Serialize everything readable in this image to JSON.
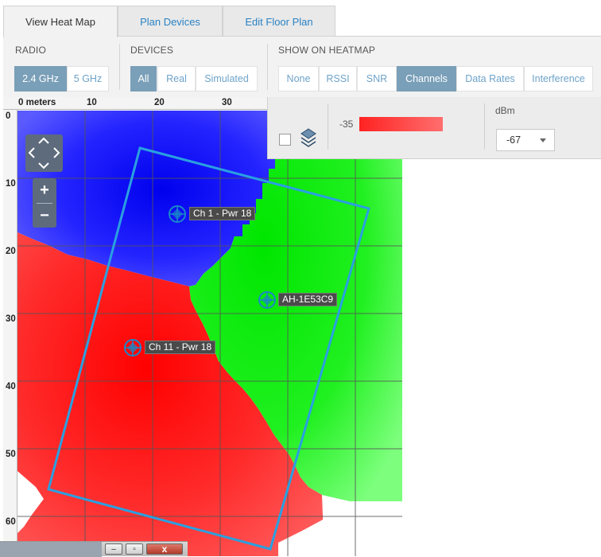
{
  "tabs": [
    {
      "label": "View Heat Map",
      "active": true
    },
    {
      "label": "Plan Devices",
      "active": false
    },
    {
      "label": "Edit Floor Plan",
      "active": false
    }
  ],
  "radio": {
    "label": "RADIO",
    "options": [
      "2.4 GHz",
      "5 GHz"
    ],
    "selected": "2.4 GHz"
  },
  "devices": {
    "label": "DEVICES",
    "options": [
      "All",
      "Real",
      "Simulated"
    ],
    "selected": "All"
  },
  "show_on_heatmap": {
    "label": "SHOW ON HEATMAP",
    "options": [
      "None",
      "RSSI",
      "SNR",
      "Channels",
      "Data Rates",
      "Interference"
    ],
    "selected": "Channels"
  },
  "ruler": {
    "x_ticks": [
      "0 meters",
      "10",
      "20",
      "30"
    ],
    "y_ticks": [
      "0",
      "10",
      "20",
      "30",
      "40",
      "50",
      "60"
    ]
  },
  "map_devices": [
    {
      "label": "Ch 1 - Pwr 18"
    },
    {
      "label": "AH-1E53C9"
    },
    {
      "label": "Ch 11 - Pwr 18"
    }
  ],
  "legend": {
    "min_value": "-35",
    "unit_label": "dBm",
    "threshold_selected": "-67"
  },
  "colors": {
    "channel_1": "#2b2bff",
    "channel_6": "#00f000",
    "channel_11": "#ff2626",
    "floor_outline": "#2aa0e0",
    "active_button": "#7a9fb8",
    "link_blue": "#2a82c4"
  },
  "window_controls": {
    "minimize": "–",
    "restore": "▫",
    "close": "x"
  }
}
